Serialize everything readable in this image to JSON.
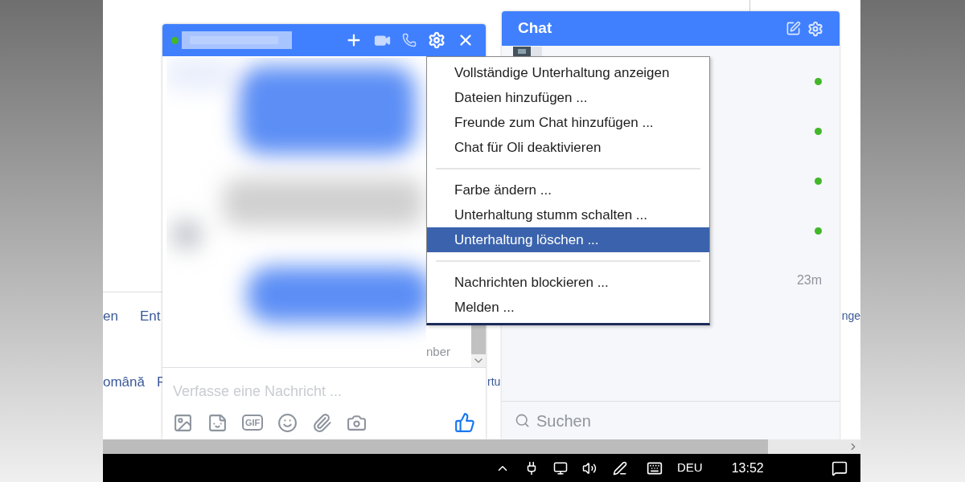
{
  "page_footer": {
    "row_1": [
      "en",
      "Ent",
      "nge"
    ],
    "row_2": [
      "omână",
      "F",
      "rtu"
    ]
  },
  "chat_window": {
    "online": true,
    "scroll_fragment": "nber",
    "composer": {
      "placeholder": "Verfasse eine Nachricht ...",
      "gif_label": "GIF"
    }
  },
  "context_menu": {
    "groups": [
      [
        {
          "label": "Vollständige Unterhaltung anzeigen",
          "selected": false
        },
        {
          "label": "Dateien hinzufügen ...",
          "selected": false
        },
        {
          "label": "Freunde zum Chat hinzufügen ...",
          "selected": false
        },
        {
          "label": "Chat für Oli deaktivieren",
          "selected": false
        }
      ],
      [
        {
          "label": "Farbe ändern ...",
          "selected": false
        },
        {
          "label": "Unterhaltung stumm schalten ...",
          "selected": false
        },
        {
          "label": "Unterhaltung löschen ...",
          "selected": true
        }
      ],
      [
        {
          "label": "Nachrichten blockieren ...",
          "selected": false
        },
        {
          "label": "Melden ...",
          "selected": false
        }
      ]
    ]
  },
  "chat_panel": {
    "title": "Chat",
    "contacts": [
      {
        "online": true
      },
      {
        "online": true
      },
      {
        "online": true
      },
      {
        "online": true
      },
      {
        "online": false,
        "time": "23m"
      }
    ],
    "search": {
      "placeholder": "Suchen"
    }
  },
  "taskbar": {
    "language": "DEU",
    "time": "13:52"
  }
}
